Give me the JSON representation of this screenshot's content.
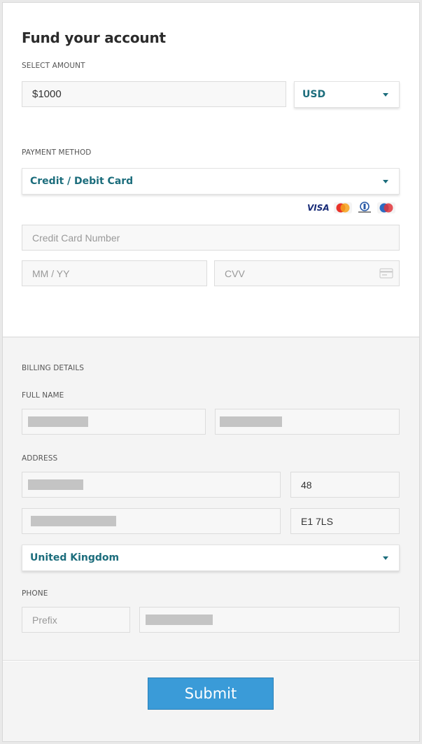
{
  "title": "Fund your account",
  "amount": {
    "label": "SELECT AMOUNT",
    "value": "$1000",
    "currency": "USD"
  },
  "payment": {
    "label": "PAYMENT METHOD",
    "method": "Credit / Debit Card",
    "card_logos": {
      "visa": "VISA",
      "icons": [
        "mastercard-icon",
        "diners-club-icon",
        "maestro-icon"
      ]
    },
    "card_number_placeholder": "Credit Card Number",
    "expiry_placeholder": "MM / YY",
    "cvv_placeholder": "CVV"
  },
  "billing": {
    "label": "BILLING DETAILS",
    "full_name_label": "FULL NAME",
    "address_label": "ADDRESS",
    "house_number": "48",
    "postcode": "E1 7LS",
    "country": "United Kingdom",
    "phone_label": "PHONE",
    "prefix_placeholder": "Prefix"
  },
  "submit_label": "Submit",
  "colors": {
    "accent_text": "#1c6d7c",
    "submit_bg": "#3a9bd8",
    "redacted": "#c4c4c4"
  }
}
